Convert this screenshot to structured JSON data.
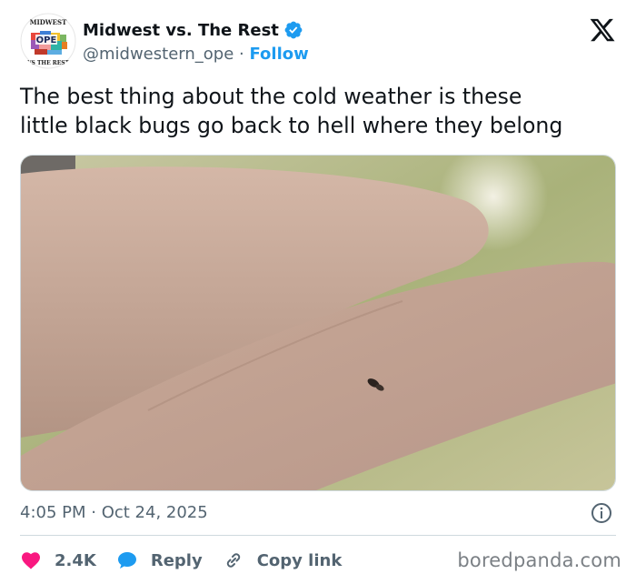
{
  "account": {
    "display_name": "Midwest vs. The Rest",
    "handle": "@midwestern_ope",
    "separator": "·",
    "follow_label": "Follow",
    "avatar_icon": "midwest-ope-logo",
    "logo_text": "OPE"
  },
  "tweet": {
    "text": "The best thing about the cold weather is these\nlittle black bugs go back to hell where they belong",
    "timestamp": "4:05 PM · Oct 24, 2025",
    "media_alt": "photo of a tiny black bug on a finger"
  },
  "actions": {
    "like_count": "2.4K",
    "reply_label": "Reply",
    "copy_label": "Copy link"
  },
  "watermark": "boredpanda.com",
  "colors": {
    "accent": "#1d9bf0",
    "heart": "#f91880",
    "text": "#0f1419",
    "muted": "#536471"
  }
}
